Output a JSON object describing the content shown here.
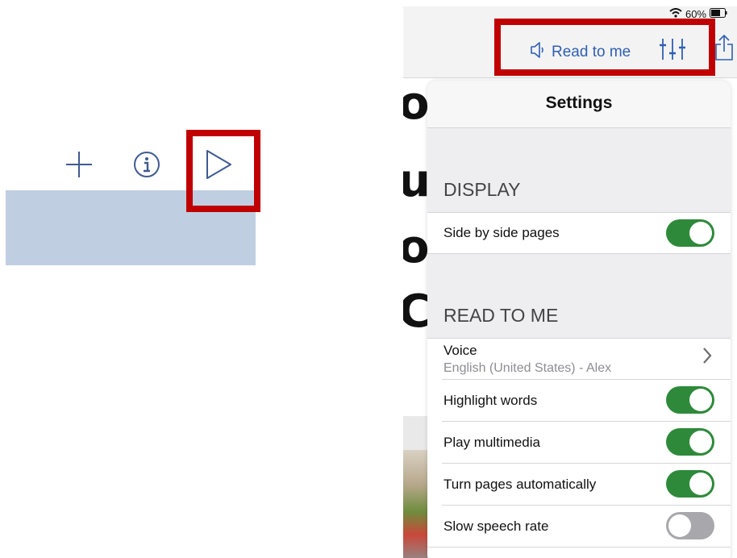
{
  "left_toolbar": {
    "add_icon": "plus-icon",
    "info_icon": "info-icon",
    "play_icon": "play-icon"
  },
  "status_bar": {
    "battery_percent": "60%"
  },
  "nav": {
    "read_to_me_label": "Read to me"
  },
  "book": {
    "letters": [
      "o",
      "u",
      "o",
      "C"
    ]
  },
  "settings": {
    "title": "Settings",
    "display_header": "DISPLAY",
    "side_by_side_label": "Side by side pages",
    "side_by_side_on": true,
    "read_to_me_header": "READ TO ME",
    "voice_label": "Voice",
    "voice_value": "English (United States) - Alex",
    "highlight_label": "Highlight words",
    "highlight_on": true,
    "multimedia_label": "Play multimedia",
    "multimedia_on": true,
    "turn_pages_label": "Turn pages automatically",
    "turn_pages_on": true,
    "slow_speech_label": "Slow speech rate",
    "slow_speech_on": false
  },
  "colors": {
    "highlight_border": "#c00000",
    "toggle_on": "#2e8a3a",
    "link_blue": "#2f5fb3",
    "left_bar": "#bfcfe1"
  }
}
